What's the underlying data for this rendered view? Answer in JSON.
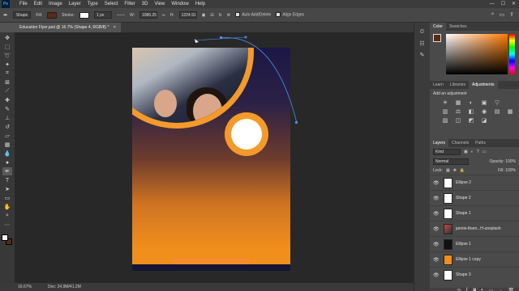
{
  "app": {
    "logo": "Ps"
  },
  "menu": [
    "File",
    "Edit",
    "Image",
    "Layer",
    "Type",
    "Select",
    "Filter",
    "3D",
    "View",
    "Window",
    "Help"
  ],
  "window_controls": [
    "—",
    "☐",
    "✕"
  ],
  "options_bar": {
    "tool_mode": "Shape",
    "fill_label": "Fill:",
    "fill_color": "#5a2b12",
    "stroke_label": "Stroke:",
    "stroke_width": "1 px",
    "w_label": "W:",
    "w_value": "1086.25",
    "h_label": "H:",
    "h_value": "1224.91",
    "auto_add_delete": "Auto Add/Delete",
    "align_edges": "Align Edges"
  },
  "document_tab": {
    "title": "Education Flyer.psd @ 16.7% (Shape 4, RGB/8) *",
    "close": "×"
  },
  "status_bar": {
    "zoom": "16.67%",
    "doc": "Doc: 24.9M/41.2M"
  },
  "panels": {
    "color_tabs": [
      "Color",
      "Swatches"
    ],
    "fg_color": "#5a2b12",
    "adj_tabs": [
      "Learn",
      "Libraries",
      "Adjustments"
    ],
    "adj_title": "Add an adjustment",
    "adj_icons": [
      "☀",
      "▦",
      "◐",
      "▣",
      "▽",
      "",
      "▥",
      "⚖",
      "◧",
      "◉",
      "▤",
      "▦",
      "▨",
      "◫",
      "◩",
      "◪",
      ""
    ],
    "layers_tabs": [
      "Layers",
      "Channels",
      "Paths"
    ],
    "kind": "Kind",
    "blend_mode": "Normal",
    "opacity_label": "Opacity:",
    "opacity_value": "100%",
    "lock_label": "Lock:",
    "fill_label": "Fill:",
    "fill_value": "100%",
    "layers": [
      {
        "name": "Ellipse 2",
        "thumb": "plain",
        "selected": false
      },
      {
        "name": "Shape 2",
        "thumb": "plain",
        "selected": false
      },
      {
        "name": "Shape 1",
        "thumb": "plain",
        "selected": false
      },
      {
        "name": "jannie-tham...H-unsplash",
        "thumb": "photo",
        "selected": false
      },
      {
        "name": "Ellipse 1",
        "thumb": "dark",
        "selected": false
      },
      {
        "name": "Ellipse 1 copy",
        "thumb": "orange",
        "selected": false
      },
      {
        "name": "Shape 3",
        "thumb": "plain",
        "selected": false
      }
    ]
  }
}
